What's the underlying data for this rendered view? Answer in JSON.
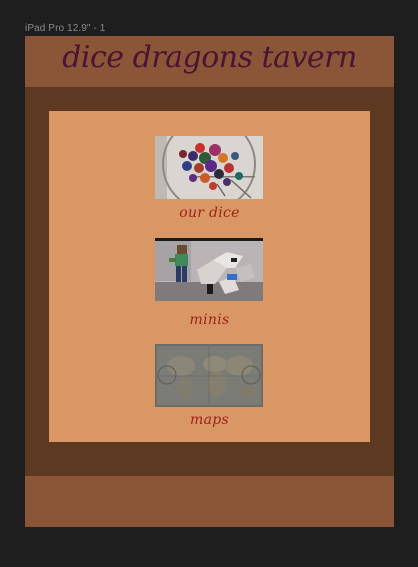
{
  "frame": {
    "label": "iPad Pro 12.9\" - 1"
  },
  "header": {
    "title": "dice dragons tavern"
  },
  "gallery": {
    "items": [
      {
        "caption": "our dice",
        "image": "dice-photo"
      },
      {
        "caption": "minis",
        "image": "miniatures-photo"
      },
      {
        "caption": "maps",
        "image": "world-map-photo"
      }
    ]
  },
  "colors": {
    "canvas": "#1e1e1e",
    "page_background": "#5e3922",
    "header_footer": "#8b5638",
    "content_panel": "#d89764",
    "title_text": "#4a1433",
    "caption_text": "#a32019"
  }
}
